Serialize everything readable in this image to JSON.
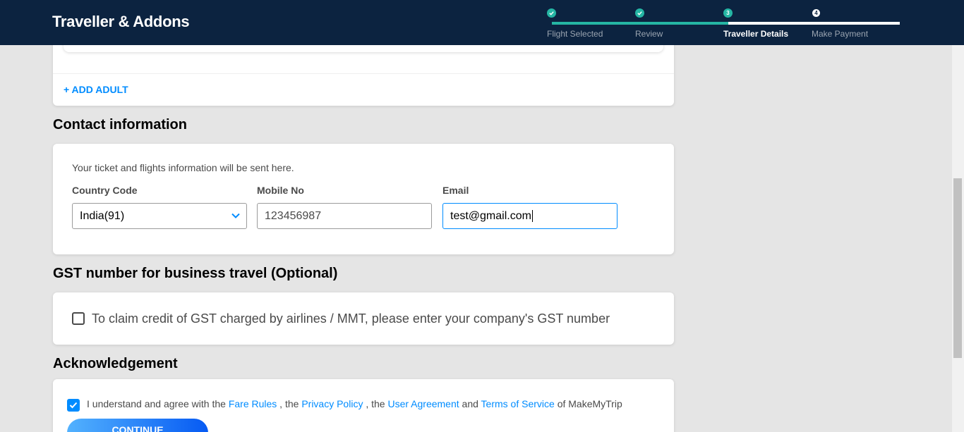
{
  "header": {
    "title": "Traveller & Addons",
    "steps": [
      {
        "number": "",
        "label": "Flight Selected"
      },
      {
        "number": "",
        "label": "Review"
      },
      {
        "number": "3",
        "label": "Traveller Details"
      },
      {
        "number": "4",
        "label": "Make Payment"
      }
    ]
  },
  "travellers": {
    "add_adult_label": "+ ADD ADULT"
  },
  "contact": {
    "section_title": "Contact information",
    "note": "Your ticket and flights information will be sent here.",
    "country_code": {
      "label": "Country Code",
      "value": "India(91)"
    },
    "mobile": {
      "label": "Mobile No",
      "value": "123456987"
    },
    "email": {
      "label": "Email",
      "value": "test@gmail.com"
    }
  },
  "gst": {
    "section_title": "GST number for business travel (Optional)",
    "checkbox_label": "To claim credit of GST charged by airlines / MMT, please enter your company's GST number",
    "checked": false
  },
  "acknowledgement": {
    "section_title": "Acknowledgement",
    "checked": true,
    "text_1": "I understand and agree with the",
    "link_fare_rules": "Fare Rules",
    "text_2": ", the",
    "link_privacy": "Privacy Policy",
    "text_3": ", the",
    "link_user_agreement": "User Agreement",
    "text_4": "and",
    "link_terms": "Terms of Service",
    "text_5": "of MakeMyTrip",
    "continue_label": "CONTINUE"
  },
  "colors": {
    "header_bg": "#0c2340",
    "accent_teal": "#25b6a4",
    "link_blue": "#008cff"
  }
}
